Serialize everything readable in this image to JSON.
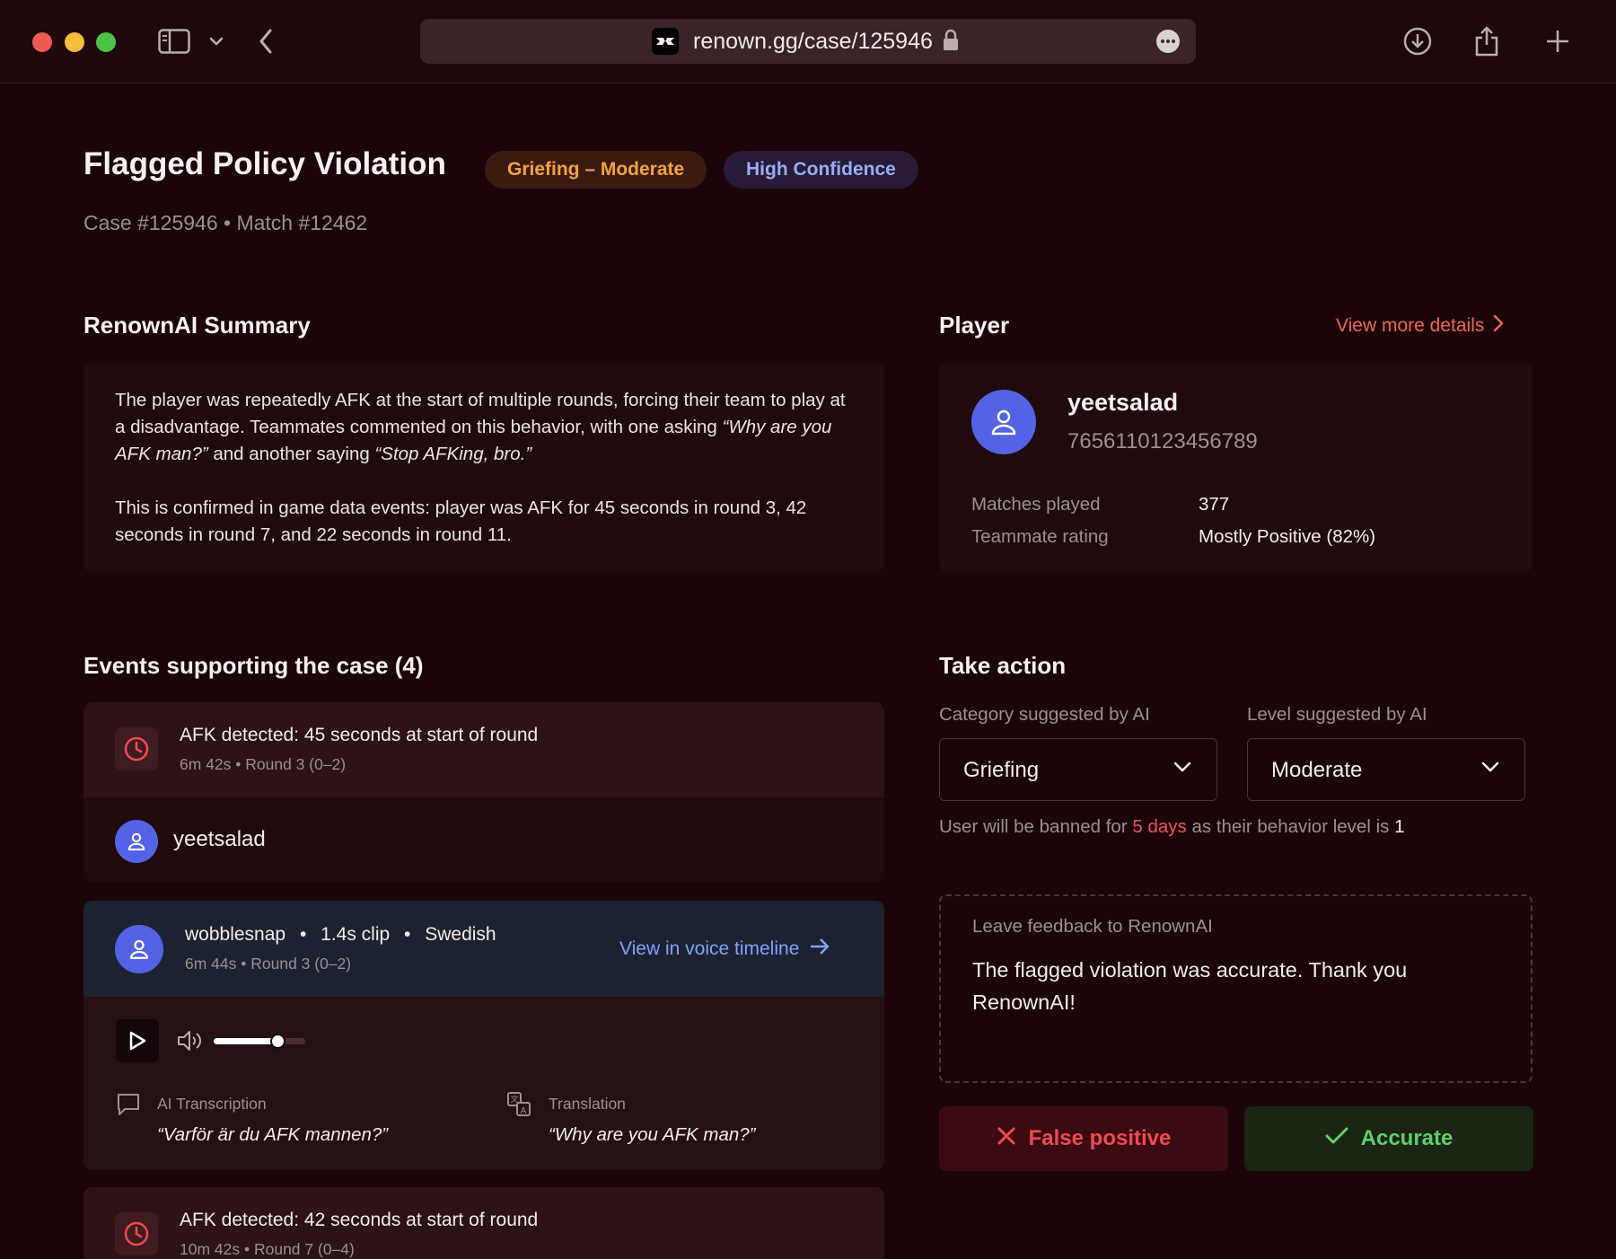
{
  "browser": {
    "url": "renown.gg/case/125946",
    "icons": [
      "sidebar-icon",
      "chevron-down-icon",
      "back-icon",
      "lock-icon",
      "more-icon",
      "download-icon",
      "share-icon",
      "new-tab-icon"
    ]
  },
  "header": {
    "title": "Flagged Policy Violation",
    "badge_category": "Griefing – Moderate",
    "badge_confidence": "High Confidence",
    "subtitle": "Case #125946 • Match #12462"
  },
  "summary": {
    "title": "RenownAI Summary",
    "p1_a": "The player was repeatedly AFK at the start of multiple rounds, forcing their team to play at a disadvantage. Teammates commented on this behavior, with one asking ",
    "p1_q1": "“Why are you AFK man?”",
    "p1_b": " and another saying ",
    "p1_q2": "“Stop AFKing, bro.”",
    "p2": "This is confirmed in game data events: player was AFK for 45 seconds in round 3, 42 seconds in round 7, and 22 seconds in round 11."
  },
  "player": {
    "title": "Player",
    "view_more": "View more details",
    "name": "yeetsalad",
    "id": "7656110123456789",
    "stats": [
      {
        "label": "Matches played",
        "value": "377"
      },
      {
        "label": "Teammate rating",
        "value": "Mostly Positive (82%)"
      }
    ]
  },
  "events": {
    "title": "Events supporting the case (4)",
    "event1": {
      "title": "AFK detected: 45 seconds at start of round",
      "meta": "6m 42s • Round 3 (0–2)",
      "player": "yeetsalad"
    },
    "voice": {
      "speaker": "wobblesnap",
      "clip": "1.4s clip",
      "language": "Swedish",
      "meta": "6m 44s • Round 3 (0–2)",
      "link": "View in voice timeline",
      "volume": 0.7,
      "transcription_label": "AI Transcription",
      "transcription": "“Varför är du AFK mannen?”",
      "translation_label": "Translation",
      "translation": "“Why are you AFK man?”"
    },
    "event2": {
      "title": "AFK detected: 42 seconds at start of round",
      "meta": "10m 42s • Round 7 (0–4)"
    }
  },
  "action": {
    "title": "Take action",
    "category_label": "Category suggested by AI",
    "category_value": "Griefing",
    "level_label": "Level suggested by AI",
    "level_value": "Moderate",
    "ban_prefix": "User will be banned for ",
    "ban_duration": "5 days",
    "ban_mid": " as their behavior level is ",
    "ban_level": "1",
    "feedback_label": "Leave feedback to RenownAI",
    "feedback_text": "The flagged violation was accurate. Thank you RenownAI!",
    "false_positive": "False positive",
    "accurate": "Accurate"
  },
  "colors": {
    "background": "#1b0508",
    "accent_orange": "#f0674f",
    "accent_blue": "#7fa3ff",
    "danger": "#f04a52",
    "success": "#5fd068",
    "avatar": "#5363e4"
  }
}
